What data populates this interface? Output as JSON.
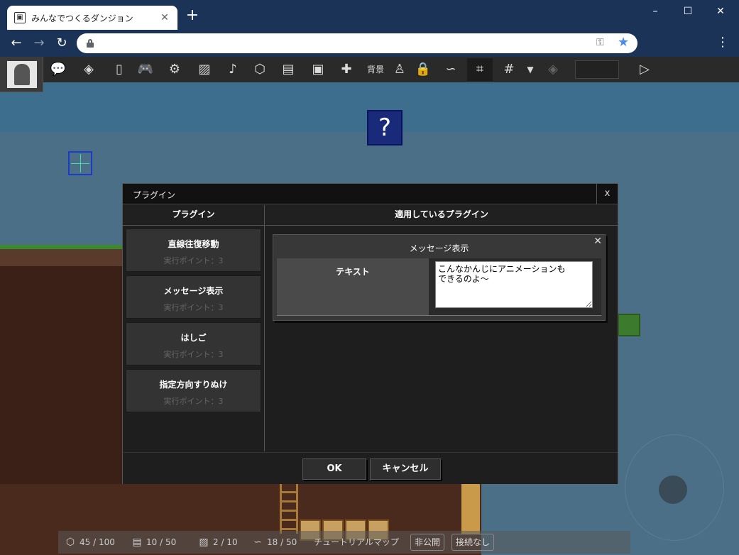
{
  "browser": {
    "tab_title": "みんなでつくるダンジョン",
    "new_tab": "+",
    "window_controls": [
      "–",
      "☐",
      "✕"
    ],
    "nav": {
      "back": "←",
      "forward": "→",
      "reload": "↻"
    },
    "url": "",
    "menu": "⋮"
  },
  "toolbar": {
    "icons": [
      "chat-icon",
      "layers-icon",
      "door-icon",
      "gamepad-icon",
      "gear-icon",
      "image-icon",
      "music-icon",
      "cube-icon",
      "film-icon",
      "save-icon",
      "puzzle-icon",
      "background-text",
      "person-icon",
      "lock-icon",
      "path-icon",
      "select-grid-icon",
      "grid-icon",
      "dropdown-icon",
      "stack-icon",
      "play-icon"
    ],
    "background_label": "背景",
    "dropdown": "▼"
  },
  "canvas": {
    "question_block": "?"
  },
  "modal": {
    "title": "プラグイン",
    "close": "x",
    "left_header": "プラグイン",
    "right_header": "適用しているプラグイン",
    "plugins": [
      {
        "name": "直線往復移動",
        "sub": "実行ポイント：3"
      },
      {
        "name": "メッセージ表示",
        "sub": "実行ポイント：3"
      },
      {
        "name": "はしご",
        "sub": "実行ポイント：3"
      },
      {
        "name": "指定方向すりぬけ",
        "sub": "実行ポイント：3"
      }
    ],
    "applied": {
      "title": "メッセージ表示",
      "close": "✕",
      "field_label": "テキスト",
      "field_value": "こんなかんじにアニメーションも\nできるのよ～"
    },
    "ok_label": "OK",
    "cancel_label": "キャンセル"
  },
  "status": {
    "objects": "45 / 100",
    "frames": "10 / 50",
    "images": "2 / 10",
    "plugins": "18 / 50",
    "map_name": "チュートリアルマップ",
    "visibility": "非公開",
    "connection": "接続なし"
  }
}
